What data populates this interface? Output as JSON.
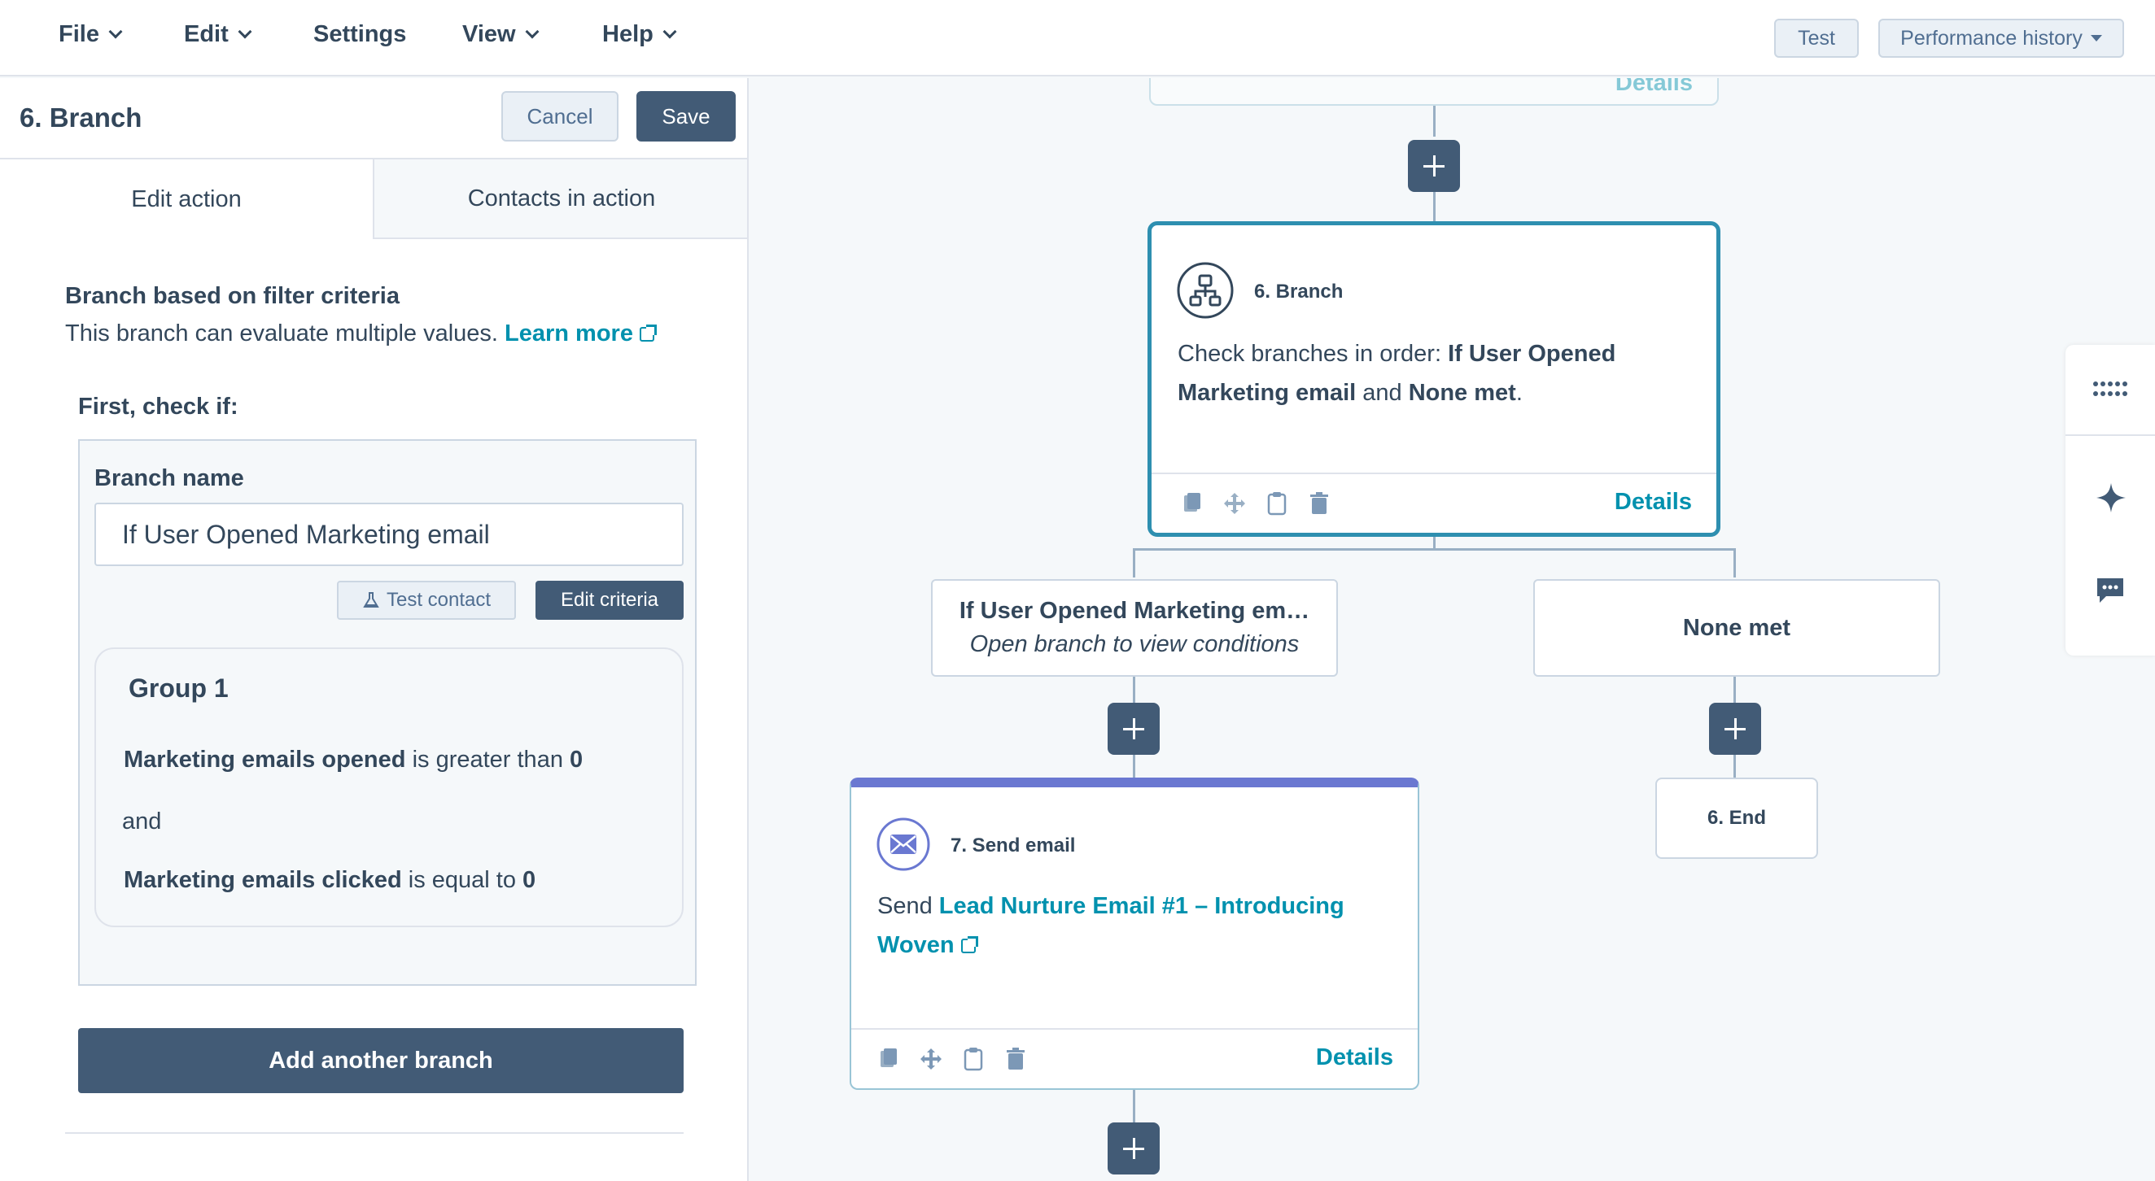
{
  "menu": {
    "file": "File",
    "edit": "Edit",
    "settings": "Settings",
    "view": "View",
    "help": "Help"
  },
  "top_buttons": {
    "test": "Test",
    "performance_history": "Performance history"
  },
  "panel": {
    "title": "6. Branch",
    "cancel": "Cancel",
    "save": "Save",
    "tabs": [
      "Edit action",
      "Contacts in action"
    ],
    "section_title": "Branch based on filter criteria",
    "section_desc": "This branch can evaluate multiple values.",
    "learn_more": "Learn more",
    "first_check": "First, check if:",
    "branch_name_label": "Branch name",
    "branch_name_value": "If User Opened Marketing email",
    "test_contact": "Test contact",
    "edit_criteria": "Edit criteria",
    "group": {
      "title": "Group 1",
      "conditions": [
        {
          "field": "Marketing emails opened",
          "op": "is greater than",
          "value": "0"
        },
        {
          "field": "Marketing emails clicked",
          "op": "is equal to",
          "value": "0"
        }
      ],
      "joiner": "and"
    },
    "add_branch": "Add another branch"
  },
  "canvas": {
    "prev_card_details": "Details",
    "branch_card": {
      "title": "6. Branch",
      "body_prefix": "Check branches in order: ",
      "branch_a": "If User Opened Marketing email",
      "and": " and ",
      "branch_b": "None met",
      "period": ".",
      "details": "Details"
    },
    "branch_nodes": {
      "a_title": "If User Opened Marketing em…",
      "a_sub": "Open branch to view conditions",
      "b_title": "None met"
    },
    "email_card": {
      "title": "7. Send email",
      "send": "Send ",
      "email_link": "Lead Nurture Email #1 – Introducing Woven",
      "details": "Details"
    },
    "end_node": "6. End"
  },
  "colors": {
    "primary": "#425b76",
    "link": "#0091ae",
    "selected_border": "#2e8fb0",
    "email_accent": "#6a78d1"
  }
}
